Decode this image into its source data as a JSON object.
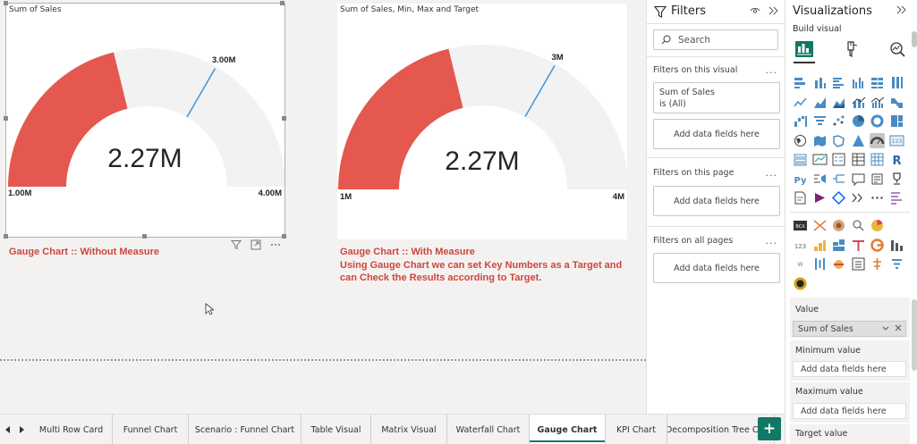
{
  "visuals": [
    {
      "title": "Sum of Sales",
      "value_label": "2.27M",
      "min_label": "1.00M",
      "max_label": "4.00M",
      "target_label": "3.00M",
      "caption_lines": [
        "Gauge Chart :: Without Measure"
      ]
    },
    {
      "title": "Sum of Sales, Min, Max and Target",
      "value_label": "2.27M",
      "min_label": "1M",
      "max_label": "4M",
      "target_label": "3M",
      "caption_lines": [
        "Gauge Chart :: With Measure",
        "Using Gauge Chart we can set Key Numbers as a Target and",
        "can Check the Results according to Target."
      ]
    }
  ],
  "gauge_data": {
    "value": 2.27,
    "min": 1,
    "max": 4,
    "target": 3,
    "fill_color": "#e5584f",
    "track_color": "#f2f2f2",
    "target_color": "#3a96dd"
  },
  "visual_header_icons": [
    "filter-icon",
    "focus-mode-icon",
    "more-options-icon"
  ],
  "filters": {
    "title": "Filters",
    "search_placeholder": "Search",
    "on_visual": "Filters on this visual",
    "card_field": "Sum of Sales",
    "card_state": "is (All)",
    "add_fields": "Add data fields here",
    "on_page": "Filters on this page",
    "on_all_pages": "Filters on all pages",
    "more": "..."
  },
  "visualizations": {
    "title": "Visualizations",
    "build_visual": "Build visual",
    "wells": {
      "value": "Value",
      "value_field": "Sum of Sales",
      "minimum": "Minimum value",
      "maximum": "Maximum value",
      "target": "Target value",
      "add_fields": "Add data fields here"
    }
  },
  "page_tabs": [
    "Multi Row Card",
    "Funnel Chart",
    "Scenario : Funnel Chart",
    "Table Visual",
    "Matrix Visual",
    "Waterfall Chart",
    "Gauge Chart",
    "KPI Chart",
    "Decomposition Tree Chart"
  ],
  "active_tab": "Gauge Chart",
  "add_page_label": "+"
}
